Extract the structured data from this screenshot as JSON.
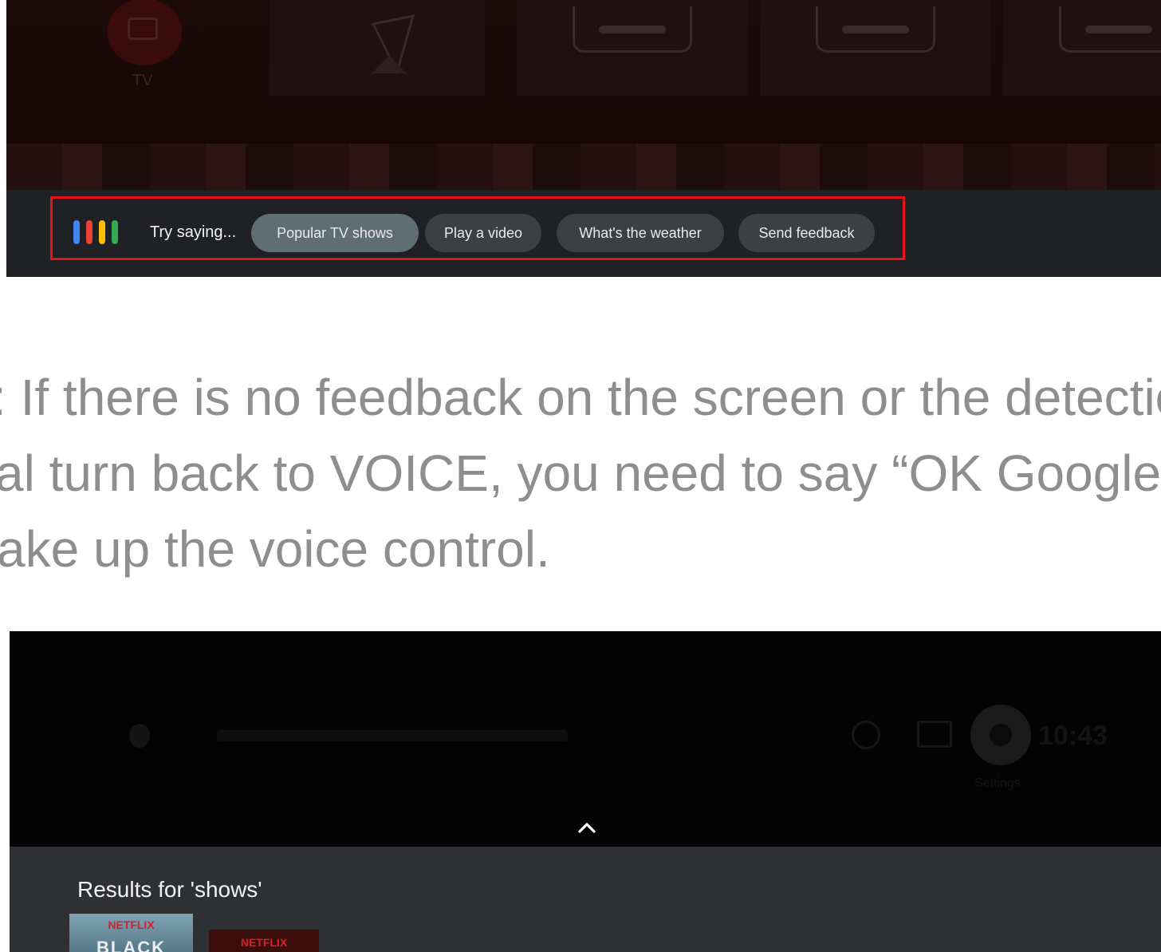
{
  "top_screenshot": {
    "tv_label": "TV",
    "assistant_bar": {
      "icon": "google-assistant-dots",
      "dot_colors": [
        "#4285F4",
        "#EA4335",
        "#FBBC05",
        "#34A853"
      ],
      "prompt": "Try saying...",
      "chips": [
        {
          "label": "Popular TV shows",
          "active": true
        },
        {
          "label": "Play a video",
          "active": false
        },
        {
          "label": "What's the weather",
          "active": false
        },
        {
          "label": "Send feedback",
          "active": false
        }
      ],
      "highlight_color": "#E8101A"
    }
  },
  "note": {
    "lines": [
      ": If there is no feedback on the screen or the detectio",
      "al turn back to VOICE, you need to say “OK Google” a",
      "ake up the voice control."
    ],
    "color": "#8E8E8E"
  },
  "bottom_screenshot": {
    "clock": "10:43",
    "settings_label": "Settings",
    "results_title": "Results for 'shows'",
    "thumbnails": [
      {
        "brand": "NETFLIX",
        "title": "BLACK"
      },
      {
        "brand": "NETFLIX"
      }
    ]
  }
}
